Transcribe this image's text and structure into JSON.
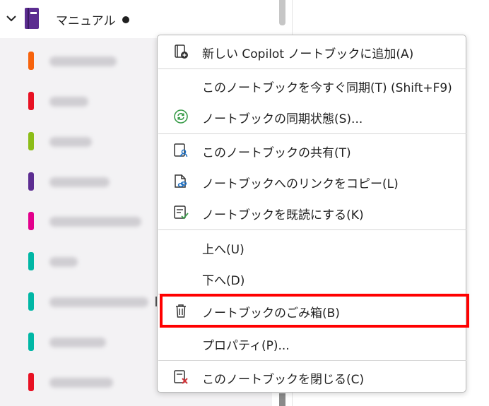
{
  "notebook": {
    "title": "マニュアル",
    "icon": "notebook-icon",
    "color": "#5c2d91"
  },
  "sections": [
    {
      "color": "#f7630c"
    },
    {
      "color": "#e81123"
    },
    {
      "color": "#8cbd18"
    },
    {
      "color": "#5c2d91"
    },
    {
      "color": "#e3008c"
    },
    {
      "color": "#00b7a5"
    },
    {
      "color": "#00b7a5"
    },
    {
      "color": "#00b7a5"
    },
    {
      "color": "#e81123"
    }
  ],
  "menu": {
    "items": [
      {
        "label": "新しい Copilot ノートブックに追加(A)",
        "icon": "new-notebook-icon"
      },
      {
        "label": "このノートブックを今すぐ同期(T)  (Shift+F9)",
        "icon": ""
      },
      {
        "label": "ノートブックの同期状態(S)...",
        "icon": "sync-icon"
      },
      {
        "label": "このノートブックの共有(T)",
        "icon": "share-icon"
      },
      {
        "label": "ノートブックへのリンクをコピー(L)",
        "icon": "link-icon"
      },
      {
        "label": "ノートブックを既読にする(K)",
        "icon": "mark-read-icon"
      },
      {
        "label": "上へ(U)",
        "icon": ""
      },
      {
        "label": "下へ(D)",
        "icon": ""
      },
      {
        "label": "ノートブックのごみ箱(B)",
        "icon": "trash-icon"
      },
      {
        "label": "プロパティ(P)...",
        "icon": ""
      },
      {
        "label": "このノートブックを閉じる(C)",
        "icon": "close-notebook-icon"
      }
    ]
  },
  "colors": {
    "highlight": "#ff0000",
    "sync_green": "#3a9c4a",
    "close_red": "#d13438"
  }
}
